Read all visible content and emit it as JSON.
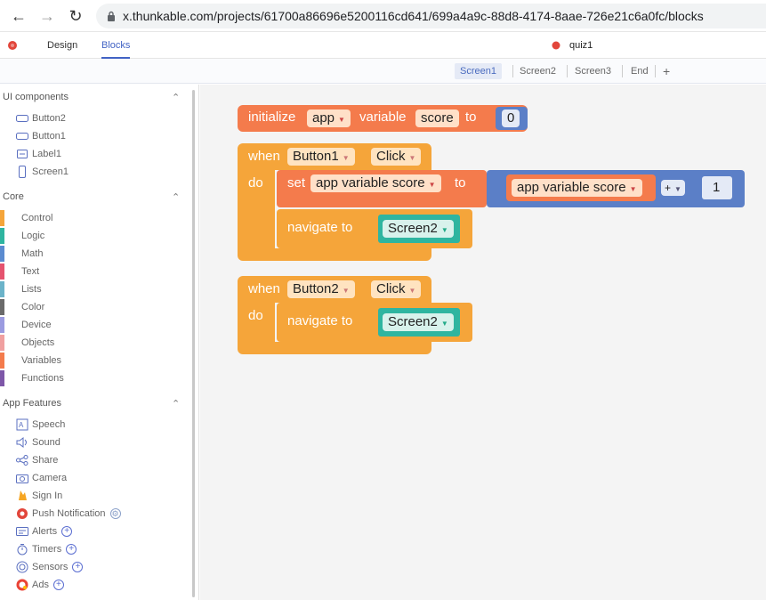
{
  "browser": {
    "back_icon": "arrow-left-icon",
    "forward_icon": "arrow-right-icon",
    "reload_icon": "reload-icon",
    "url": "x.thunkable.com/projects/61700a86696e5200116cd641/699a4a9c-88d8-4174-8aae-726e21c6a0fc/blocks"
  },
  "header": {
    "tabs": [
      {
        "label": "Design"
      },
      {
        "label": "Blocks"
      }
    ],
    "active_tab": "Blocks",
    "project_name": "quiz1"
  },
  "screens": {
    "tabs": [
      {
        "label": "Screen1"
      },
      {
        "label": "Screen2"
      },
      {
        "label": "Screen3"
      },
      {
        "label": "End"
      }
    ],
    "add_label": "+",
    "active": "Screen1"
  },
  "sidebar": {
    "ui_components": {
      "title": "UI components",
      "items": [
        {
          "label": "Button2"
        },
        {
          "label": "Button1"
        },
        {
          "label": "Label1"
        },
        {
          "label": "Screen1"
        }
      ]
    },
    "core": {
      "title": "Core",
      "items": [
        {
          "label": "Control",
          "color": "#f5a53a"
        },
        {
          "label": "Logic",
          "color": "#2fb5a0"
        },
        {
          "label": "Math",
          "color": "#5b8bd0"
        },
        {
          "label": "Text",
          "color": "#e5536f"
        },
        {
          "label": "Lists",
          "color": "#6bb3c9"
        },
        {
          "label": "Color",
          "color": "#6a6a6a"
        },
        {
          "label": "Device",
          "color": "#9b9be0"
        },
        {
          "label": "Objects",
          "color": "#f0a0a0"
        },
        {
          "label": "Variables",
          "color": "#f47b4c"
        },
        {
          "label": "Functions",
          "color": "#7e57a8"
        }
      ]
    },
    "app_features": {
      "title": "App Features",
      "items": [
        {
          "label": "Speech"
        },
        {
          "label": "Sound"
        },
        {
          "label": "Share"
        },
        {
          "label": "Camera"
        },
        {
          "label": "Sign In"
        },
        {
          "label": "Push Notification"
        },
        {
          "label": "Alerts"
        },
        {
          "label": "Timers"
        },
        {
          "label": "Sensors"
        },
        {
          "label": "Ads"
        }
      ]
    }
  },
  "blocks": {
    "init": {
      "initialize": "initialize",
      "scope": "app",
      "variable": "variable",
      "name": "score",
      "to": "to",
      "value": "0"
    },
    "event1": {
      "when": "when",
      "component": "Button1",
      "event": "Click",
      "do": "do",
      "set": {
        "set": "set",
        "target": "app variable score",
        "to": "to",
        "getter": "app variable score",
        "op": "+",
        "operand": "1"
      },
      "navigate": {
        "label": "navigate to",
        "screen": "Screen2"
      }
    },
    "event2": {
      "when": "when",
      "component": "Button2",
      "event": "Click",
      "do": "do",
      "navigate": {
        "label": "navigate to",
        "screen": "Screen2"
      }
    },
    "colors": {
      "variables": "#f47b4c",
      "control": "#f5a53a",
      "math": "#5b7fc7",
      "screen": "#2fb5a0"
    }
  }
}
